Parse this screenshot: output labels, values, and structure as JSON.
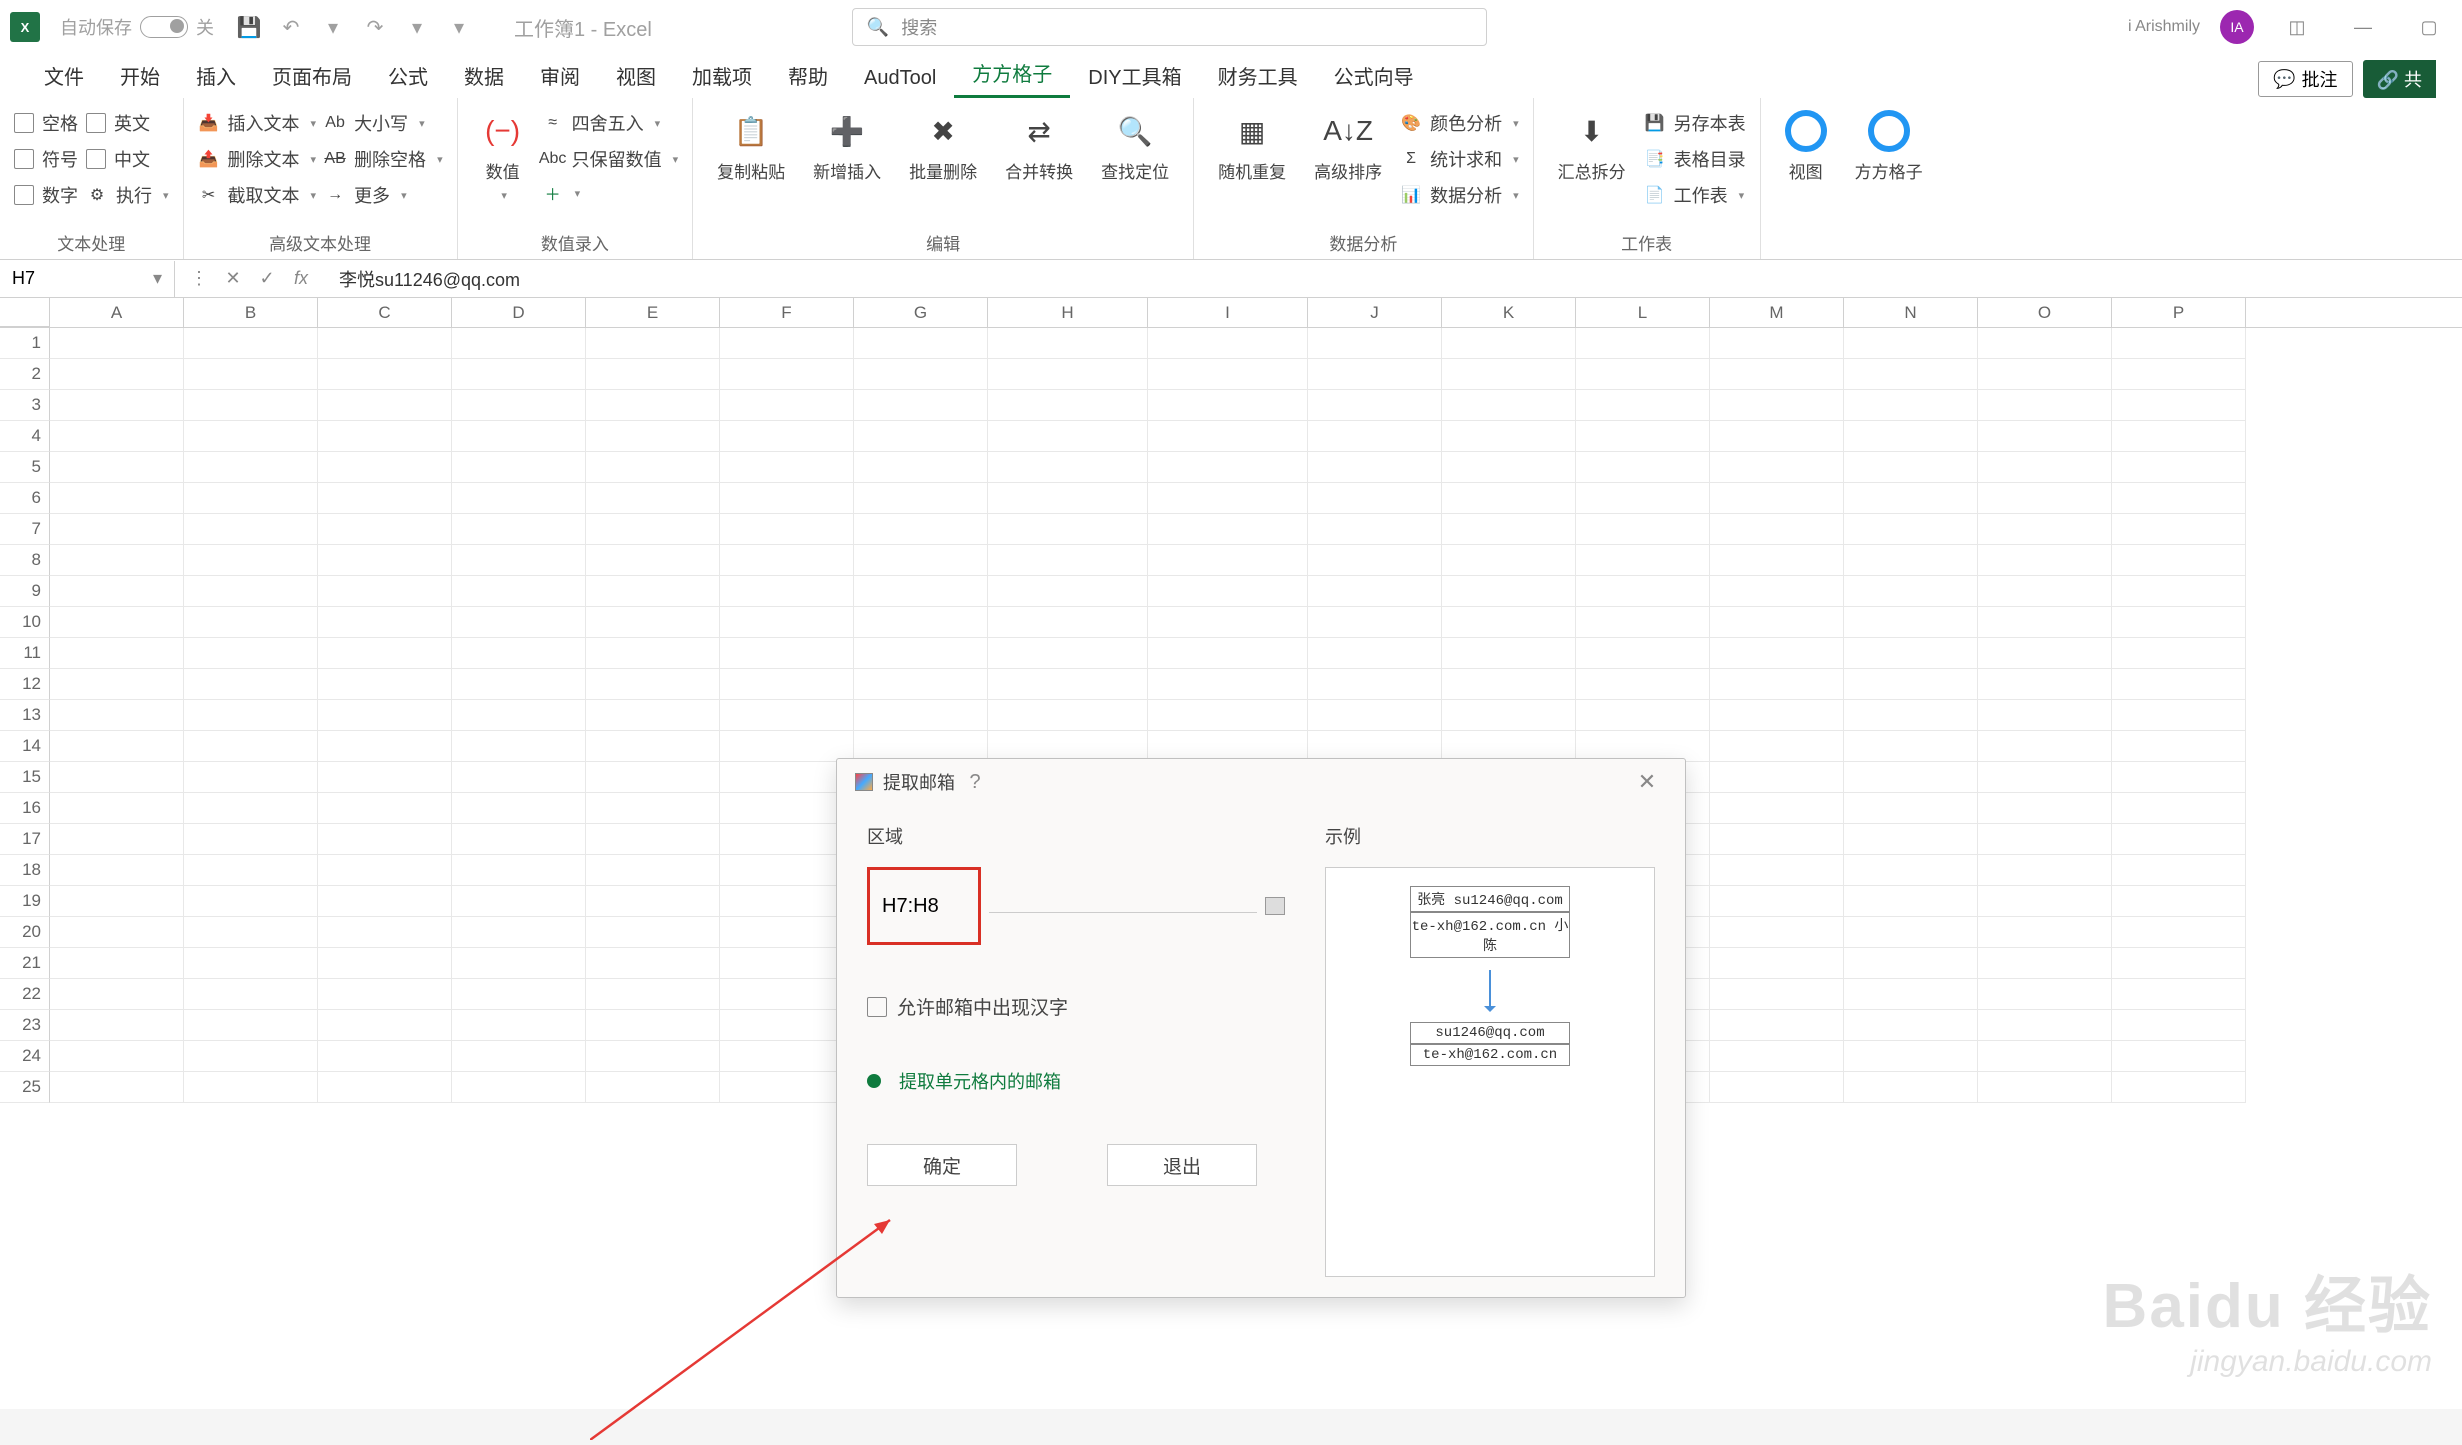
{
  "titlebar": {
    "autosave_label": "自动保存",
    "autosave_state": "关",
    "doc_title": "工作簿1 - Excel",
    "search_placeholder": "搜索",
    "user_name": "i Arishmily",
    "avatar_initials": "IA"
  },
  "menu": {
    "items": [
      "文件",
      "开始",
      "插入",
      "页面布局",
      "公式",
      "数据",
      "审阅",
      "视图",
      "加载项",
      "帮助",
      "AudTool",
      "方方格子",
      "DIY工具箱",
      "财务工具",
      "公式向导"
    ],
    "active": "方方格子",
    "comments": "批注",
    "share": "共"
  },
  "ribbon": {
    "group1": {
      "label": "文本处理",
      "items": [
        "空格",
        "英文",
        "符号",
        "中文",
        "数字",
        "执行"
      ]
    },
    "group2": {
      "label": "高级文本处理",
      "insert": "插入文本",
      "delete": "删除文本",
      "cut": "截取文本",
      "case": "大小写",
      "delspace": "删除空格",
      "more": "更多"
    },
    "group3": {
      "label": "数值录入",
      "num": "数值",
      "round": "四舍五入",
      "keeponly": "只保留数值"
    },
    "group4": {
      "label": "编辑",
      "copypaste": "复制粘贴",
      "insertnew": "新增插入",
      "batchdel": "批量删除",
      "mergeconv": "合并转换",
      "findpos": "查找定位"
    },
    "group5": {
      "label": "数据分析",
      "shuffle": "随机重复",
      "advsort": "高级排序",
      "coloranalysis": "颜色分析",
      "sum": "统计求和",
      "dataanalysis": "数据分析"
    },
    "group6": {
      "label": "工作表",
      "summary": "汇总拆分",
      "saveas": "另存本表",
      "toc": "表格目录",
      "sheet": "工作表"
    },
    "group7": {
      "view": "视图",
      "ffgz": "方方格子"
    }
  },
  "formulabar": {
    "namebox": "H7",
    "formula": "李悦su11246@qq.com"
  },
  "columns": [
    "A",
    "B",
    "C",
    "D",
    "E",
    "F",
    "G",
    "H",
    "I",
    "J",
    "K",
    "L",
    "M",
    "N",
    "O",
    "P"
  ],
  "rows_count": 25,
  "dialog": {
    "title": "提取邮箱",
    "area_label": "区域",
    "example_label": "示例",
    "range_value": "H7:H8",
    "allow_cn": "允许邮箱中出现汉字",
    "info": "提取单元格内的邮箱",
    "ok": "确定",
    "exit": "退出",
    "example_before": [
      "张亮 su1246@qq.com",
      "te-xh@162.com.cn 小陈"
    ],
    "example_after": [
      "su1246@qq.com",
      "te-xh@162.com.cn"
    ]
  },
  "watermark": {
    "brand": "Baidu 经验",
    "sub": "jingyan.baidu.com"
  }
}
